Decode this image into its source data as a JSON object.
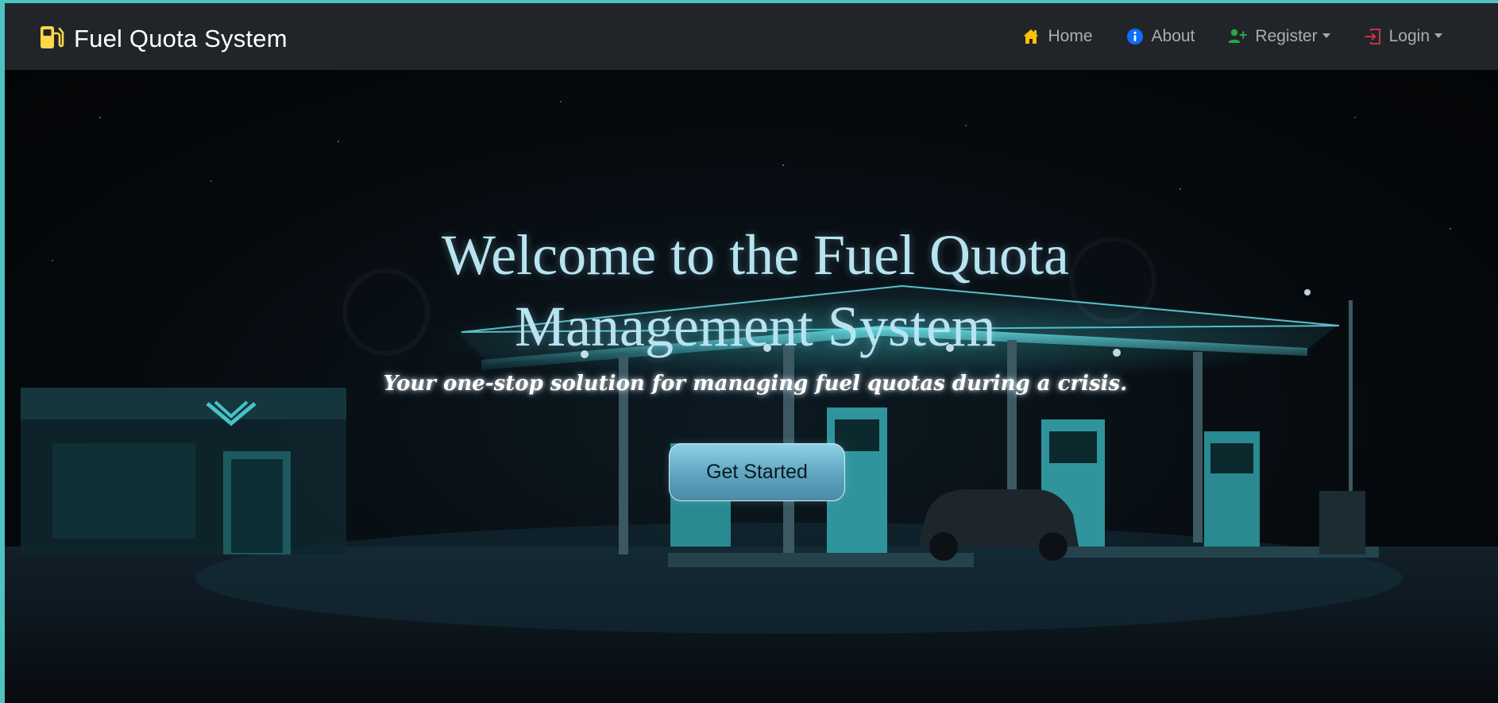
{
  "navbar": {
    "brand": "Fuel Quota System",
    "items": [
      {
        "label": "Home",
        "icon": "home-icon",
        "icon_color": "#ffc107"
      },
      {
        "label": "About",
        "icon": "info-circle-icon",
        "icon_color": "#0d6efd"
      },
      {
        "label": "Register",
        "icon": "person-plus-icon",
        "icon_color": "#28a745",
        "dropdown": true
      },
      {
        "label": "Login",
        "icon": "login-arrow-icon",
        "icon_color": "#dc3545",
        "dropdown": true
      }
    ]
  },
  "hero": {
    "title_line1": "Welcome to the Fuel Quota",
    "title_line2": "Management System",
    "subtitle": "Your one-stop solution for managing fuel quotas during a crisis.",
    "cta_label": "Get Started",
    "background_image": "night gas station illustration"
  },
  "colors": {
    "navbar_bg": "#212529",
    "title_color": "#b8e4f2",
    "cta_bg": "#5ea4bf",
    "page_border": "#4ec3c1",
    "brand_icon": "#ffd54a"
  }
}
